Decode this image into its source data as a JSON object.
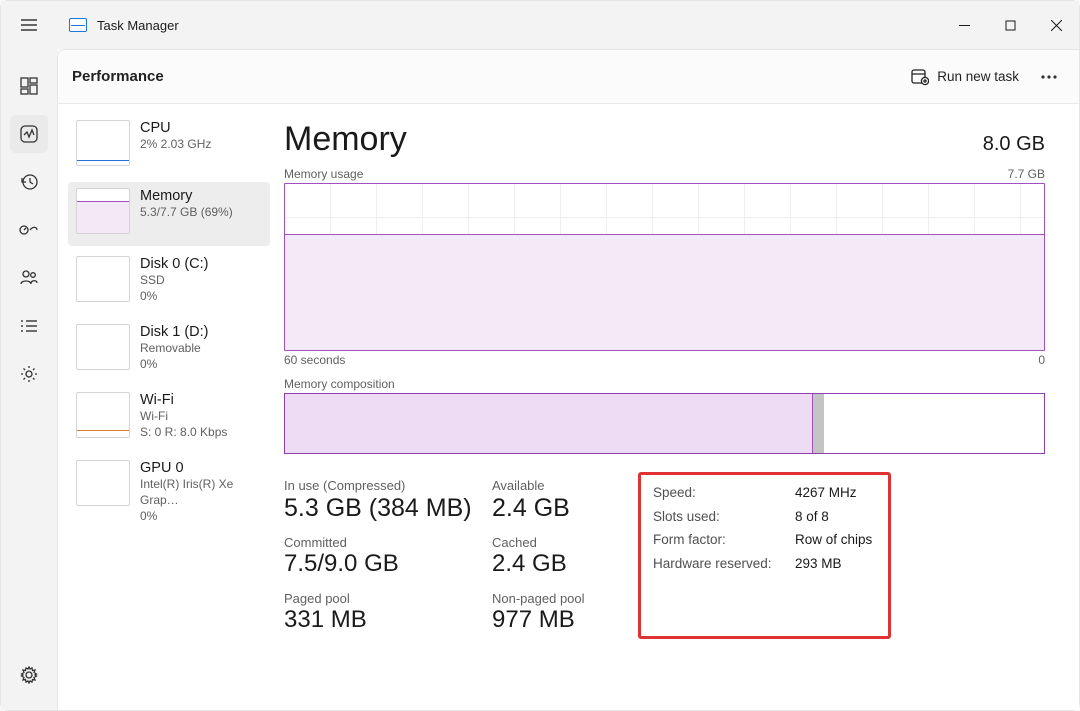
{
  "app_title": "Task Manager",
  "toolbar": {
    "page_title": "Performance",
    "run_new_task": "Run new task"
  },
  "perf_items": {
    "cpu": {
      "name": "CPU",
      "sub": "2%  2.03 GHz",
      "sub2": ""
    },
    "mem": {
      "name": "Memory",
      "sub": "5.3/7.7 GB (69%)",
      "sub2": ""
    },
    "disk0": {
      "name": "Disk 0 (C:)",
      "sub": "SSD",
      "sub2": "0%"
    },
    "disk1": {
      "name": "Disk 1 (D:)",
      "sub": "Removable",
      "sub2": "0%"
    },
    "wifi": {
      "name": "Wi-Fi",
      "sub": "Wi-Fi",
      "sub2": "S: 0  R: 8.0 Kbps"
    },
    "gpu": {
      "name": "GPU 0",
      "sub": "Intel(R) Iris(R) Xe Grap…",
      "sub2": "0%"
    }
  },
  "detail": {
    "title": "Memory",
    "total": "8.0 GB",
    "chart1_label": "Memory usage",
    "chart1_max": "7.7 GB",
    "axis_left": "60 seconds",
    "axis_right": "0",
    "comp_label": "Memory composition",
    "stats": {
      "in_use_label": "In use (Compressed)",
      "in_use_value": "5.3 GB (384 MB)",
      "available_label": "Available",
      "available_value": "2.4 GB",
      "committed_label": "Committed",
      "committed_value": "7.5/9.0 GB",
      "cached_label": "Cached",
      "cached_value": "2.4 GB",
      "paged_label": "Paged pool",
      "paged_value": "331 MB",
      "nonpaged_label": "Non-paged pool",
      "nonpaged_value": "977 MB"
    },
    "hw": {
      "speed_label": "Speed:",
      "speed_value": "4267 MHz",
      "slots_label": "Slots used:",
      "slots_value": "8 of 8",
      "form_label": "Form factor:",
      "form_value": "Row of chips",
      "hres_label": "Hardware reserved:",
      "hres_value": "293 MB"
    }
  }
}
